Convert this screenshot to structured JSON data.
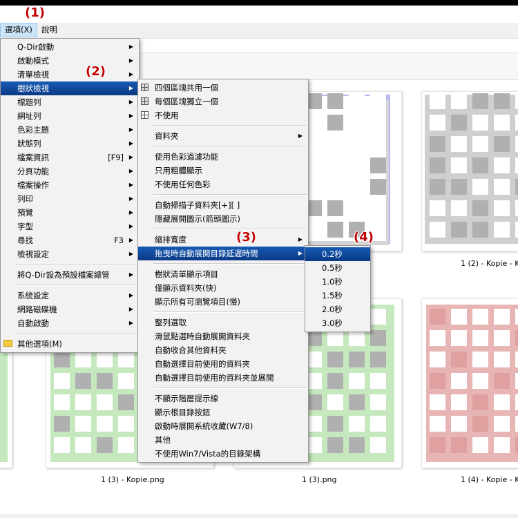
{
  "menubar": {
    "options": "選項(X)",
    "help": "說明"
  },
  "markers": {
    "m1": "(1)",
    "m2": "(2)",
    "m3": "(3)",
    "m4": "(4)"
  },
  "main_menu": {
    "items": [
      {
        "label": "Q-Dir啟動"
      },
      {
        "label": "啟動模式"
      },
      {
        "label": "清單檢視"
      },
      {
        "label": "樹狀檢視"
      },
      {
        "label": "標題列"
      },
      {
        "label": "網址列"
      },
      {
        "label": "色彩主題"
      },
      {
        "label": "狀態列"
      },
      {
        "label": "檔案資訊",
        "shortcut": "[F9]"
      },
      {
        "label": "分頁功能"
      },
      {
        "label": "檔案操作"
      },
      {
        "label": "列印"
      },
      {
        "label": "預覽"
      },
      {
        "label": "字型"
      },
      {
        "label": "尋找",
        "shortcut": "F3"
      },
      {
        "label": "檢視設定"
      },
      {
        "label": "將Q-Dir設為預設檔案總管"
      },
      {
        "label": "系統設定"
      },
      {
        "label": "網路磁碟機"
      },
      {
        "label": "自動啟動"
      },
      {
        "label": "其他選項(M)"
      }
    ]
  },
  "tree_menu": {
    "items": [
      {
        "label": "四個區塊共用一個"
      },
      {
        "label": "每個區塊獨立一個"
      },
      {
        "label": "不使用"
      },
      {
        "label": "資料夾"
      },
      {
        "label": "使用色彩過濾功能"
      },
      {
        "label": "只用粗體顯示"
      },
      {
        "label": "不使用任何色彩"
      },
      {
        "label": "自動掃描子資料夾[+][ ]"
      },
      {
        "label": "隱藏展開圖示(箭頭圖示)"
      },
      {
        "label": "縮排寬度"
      },
      {
        "label": "拖曳時自動展開目錄延遲時間"
      },
      {
        "label": "樹狀清單顯示項目"
      },
      {
        "label": "僅顯示資料夾(快)"
      },
      {
        "label": "顯示所有可瀏覽項目(慢)"
      },
      {
        "label": "整列選取"
      },
      {
        "label": "滑鼠點選時自動展開資料夾"
      },
      {
        "label": "自動收合其他資料夾"
      },
      {
        "label": "自動選擇目前使用的資料夾"
      },
      {
        "label": "自動選擇目前使用的資料夾並展開"
      },
      {
        "label": "不顯示階層提示線"
      },
      {
        "label": "顯示根目錄按鈕"
      },
      {
        "label": "啟動時展開系統收藏(W7/8)"
      },
      {
        "label": "其他"
      },
      {
        "label": "不使用Win7/Vista的目錄架構"
      }
    ]
  },
  "delay_menu": {
    "items": [
      {
        "label": "0.2秒"
      },
      {
        "label": "0.5秒"
      },
      {
        "label": "1.0秒"
      },
      {
        "label": "1.5秒"
      },
      {
        "label": "2.0秒"
      },
      {
        "label": "3.0秒"
      }
    ]
  },
  "files": {
    "cap1": "1 (2) - Kopie - K",
    "cap2": "1 (3) - Kopie.png",
    "cap3": "1 (3).png",
    "cap4": "1 (4) - Kopie - K"
  },
  "colors": {
    "menu_highlight": "#0a3a84",
    "marker_red": "#c00000",
    "thumb_blue": "#b8b8ee",
    "thumb_gray": "#cfcfcf",
    "thumb_green": "#c6e8bf",
    "thumb_red": "#e8b5b5"
  }
}
